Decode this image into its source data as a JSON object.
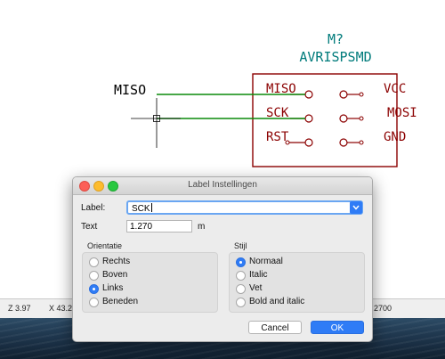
{
  "schematic": {
    "ref": "M?",
    "value": "AVRISPSMD",
    "left_pins": [
      "MISO",
      "SCK",
      "RST"
    ],
    "right_pins": [
      "VCC",
      "MOSI",
      "GND"
    ],
    "net_label": "MISO",
    "colors": {
      "component": "#8b0000",
      "text": "#000000",
      "wire": "#0a8a0a",
      "ref_text": "#007b7b"
    }
  },
  "statusbar": {
    "zoom": "Z 3.97",
    "x_coord": "X 43.2",
    "coord_right": "2700"
  },
  "dialog": {
    "title": "Label Instellingen",
    "label_field": {
      "label": "Label:",
      "value": "SCK"
    },
    "text_field": {
      "label": "Text",
      "value": "1.270",
      "unit": "m"
    },
    "orientation": {
      "title": "Orientatie",
      "options": [
        "Rechts",
        "Boven",
        "Links",
        "Beneden"
      ],
      "selected": "Links"
    },
    "style": {
      "title": "Stijl",
      "options": [
        "Normaal",
        "Italic",
        "Vet",
        "Bold and italic"
      ],
      "selected": "Normaal"
    },
    "buttons": {
      "cancel": "Cancel",
      "ok": "OK"
    },
    "colors": {
      "accent": "#2f7cf6"
    }
  }
}
